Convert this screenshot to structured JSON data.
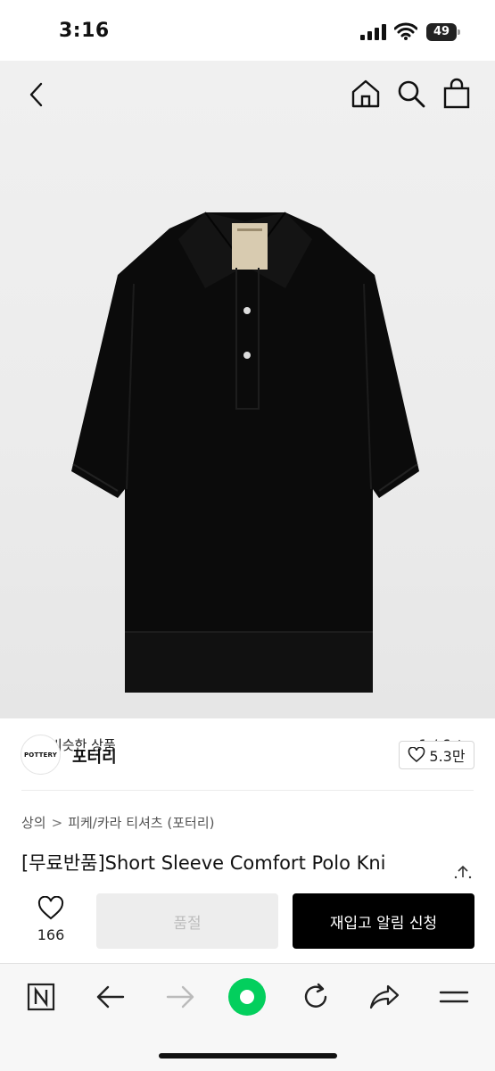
{
  "status_bar": {
    "time": "3:16",
    "battery": "49"
  },
  "product_nav": {
    "back_icon": "chevron-left-icon",
    "home_icon": "home-icon",
    "search_icon": "search-icon",
    "cart_icon": "shopping-bag-icon"
  },
  "gallery": {
    "similar_label": "비슷한 상품",
    "pager": "1 / 6"
  },
  "brand": {
    "logo_text": "POTTERY",
    "name": "포터리",
    "likes": "5.3만"
  },
  "breadcrumb": {
    "category": "상의",
    "separator": ">",
    "subcategory": "피케/카라 티셔츠 (포터리)"
  },
  "product": {
    "title": "[무료반품]Short Sleeve Comfort Polo Kni"
  },
  "purchase": {
    "wish_count": "166",
    "soldout_label": "품절",
    "restock_label": "재입고 알림 신청"
  },
  "browser_toolbar": {
    "items": [
      "n-logo-icon",
      "back-arrow-icon",
      "forward-arrow-icon",
      "green-dot-icon",
      "refresh-icon",
      "share-icon",
      "menu-icon"
    ],
    "accent": "#03cf5d"
  }
}
